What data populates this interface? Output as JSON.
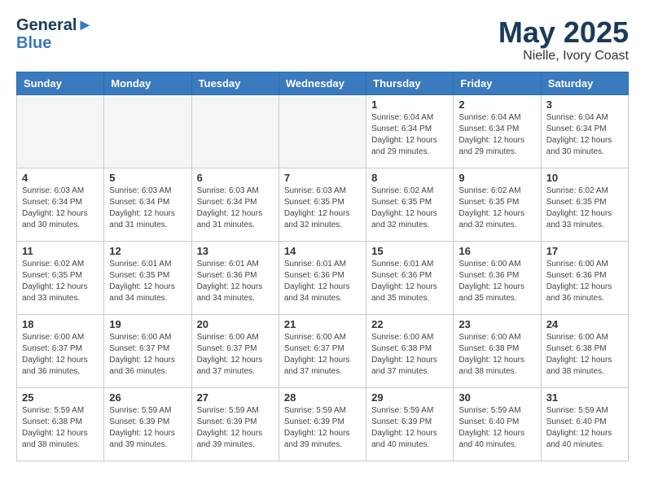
{
  "header": {
    "logo_line1": "General",
    "logo_line2": "Blue",
    "month_year": "May 2025",
    "location": "Nielle, Ivory Coast"
  },
  "weekdays": [
    "Sunday",
    "Monday",
    "Tuesday",
    "Wednesday",
    "Thursday",
    "Friday",
    "Saturday"
  ],
  "weeks": [
    [
      {
        "day": "",
        "text": ""
      },
      {
        "day": "",
        "text": ""
      },
      {
        "day": "",
        "text": ""
      },
      {
        "day": "",
        "text": ""
      },
      {
        "day": "1",
        "text": "Sunrise: 6:04 AM\nSunset: 6:34 PM\nDaylight: 12 hours\nand 29 minutes."
      },
      {
        "day": "2",
        "text": "Sunrise: 6:04 AM\nSunset: 6:34 PM\nDaylight: 12 hours\nand 29 minutes."
      },
      {
        "day": "3",
        "text": "Sunrise: 6:04 AM\nSunset: 6:34 PM\nDaylight: 12 hours\nand 30 minutes."
      }
    ],
    [
      {
        "day": "4",
        "text": "Sunrise: 6:03 AM\nSunset: 6:34 PM\nDaylight: 12 hours\nand 30 minutes."
      },
      {
        "day": "5",
        "text": "Sunrise: 6:03 AM\nSunset: 6:34 PM\nDaylight: 12 hours\nand 31 minutes."
      },
      {
        "day": "6",
        "text": "Sunrise: 6:03 AM\nSunset: 6:34 PM\nDaylight: 12 hours\nand 31 minutes."
      },
      {
        "day": "7",
        "text": "Sunrise: 6:03 AM\nSunset: 6:35 PM\nDaylight: 12 hours\nand 32 minutes."
      },
      {
        "day": "8",
        "text": "Sunrise: 6:02 AM\nSunset: 6:35 PM\nDaylight: 12 hours\nand 32 minutes."
      },
      {
        "day": "9",
        "text": "Sunrise: 6:02 AM\nSunset: 6:35 PM\nDaylight: 12 hours\nand 32 minutes."
      },
      {
        "day": "10",
        "text": "Sunrise: 6:02 AM\nSunset: 6:35 PM\nDaylight: 12 hours\nand 33 minutes."
      }
    ],
    [
      {
        "day": "11",
        "text": "Sunrise: 6:02 AM\nSunset: 6:35 PM\nDaylight: 12 hours\nand 33 minutes."
      },
      {
        "day": "12",
        "text": "Sunrise: 6:01 AM\nSunset: 6:35 PM\nDaylight: 12 hours\nand 34 minutes."
      },
      {
        "day": "13",
        "text": "Sunrise: 6:01 AM\nSunset: 6:36 PM\nDaylight: 12 hours\nand 34 minutes."
      },
      {
        "day": "14",
        "text": "Sunrise: 6:01 AM\nSunset: 6:36 PM\nDaylight: 12 hours\nand 34 minutes."
      },
      {
        "day": "15",
        "text": "Sunrise: 6:01 AM\nSunset: 6:36 PM\nDaylight: 12 hours\nand 35 minutes."
      },
      {
        "day": "16",
        "text": "Sunrise: 6:00 AM\nSunset: 6:36 PM\nDaylight: 12 hours\nand 35 minutes."
      },
      {
        "day": "17",
        "text": "Sunrise: 6:00 AM\nSunset: 6:36 PM\nDaylight: 12 hours\nand 36 minutes."
      }
    ],
    [
      {
        "day": "18",
        "text": "Sunrise: 6:00 AM\nSunset: 6:37 PM\nDaylight: 12 hours\nand 36 minutes."
      },
      {
        "day": "19",
        "text": "Sunrise: 6:00 AM\nSunset: 6:37 PM\nDaylight: 12 hours\nand 36 minutes."
      },
      {
        "day": "20",
        "text": "Sunrise: 6:00 AM\nSunset: 6:37 PM\nDaylight: 12 hours\nand 37 minutes."
      },
      {
        "day": "21",
        "text": "Sunrise: 6:00 AM\nSunset: 6:37 PM\nDaylight: 12 hours\nand 37 minutes."
      },
      {
        "day": "22",
        "text": "Sunrise: 6:00 AM\nSunset: 6:38 PM\nDaylight: 12 hours\nand 37 minutes."
      },
      {
        "day": "23",
        "text": "Sunrise: 6:00 AM\nSunset: 6:38 PM\nDaylight: 12 hours\nand 38 minutes."
      },
      {
        "day": "24",
        "text": "Sunrise: 6:00 AM\nSunset: 6:38 PM\nDaylight: 12 hours\nand 38 minutes."
      }
    ],
    [
      {
        "day": "25",
        "text": "Sunrise: 5:59 AM\nSunset: 6:38 PM\nDaylight: 12 hours\nand 38 minutes."
      },
      {
        "day": "26",
        "text": "Sunrise: 5:59 AM\nSunset: 6:39 PM\nDaylight: 12 hours\nand 39 minutes."
      },
      {
        "day": "27",
        "text": "Sunrise: 5:59 AM\nSunset: 6:39 PM\nDaylight: 12 hours\nand 39 minutes."
      },
      {
        "day": "28",
        "text": "Sunrise: 5:59 AM\nSunset: 6:39 PM\nDaylight: 12 hours\nand 39 minutes."
      },
      {
        "day": "29",
        "text": "Sunrise: 5:59 AM\nSunset: 6:39 PM\nDaylight: 12 hours\nand 40 minutes."
      },
      {
        "day": "30",
        "text": "Sunrise: 5:59 AM\nSunset: 6:40 PM\nDaylight: 12 hours\nand 40 minutes."
      },
      {
        "day": "31",
        "text": "Sunrise: 5:59 AM\nSunset: 6:40 PM\nDaylight: 12 hours\nand 40 minutes."
      }
    ]
  ]
}
